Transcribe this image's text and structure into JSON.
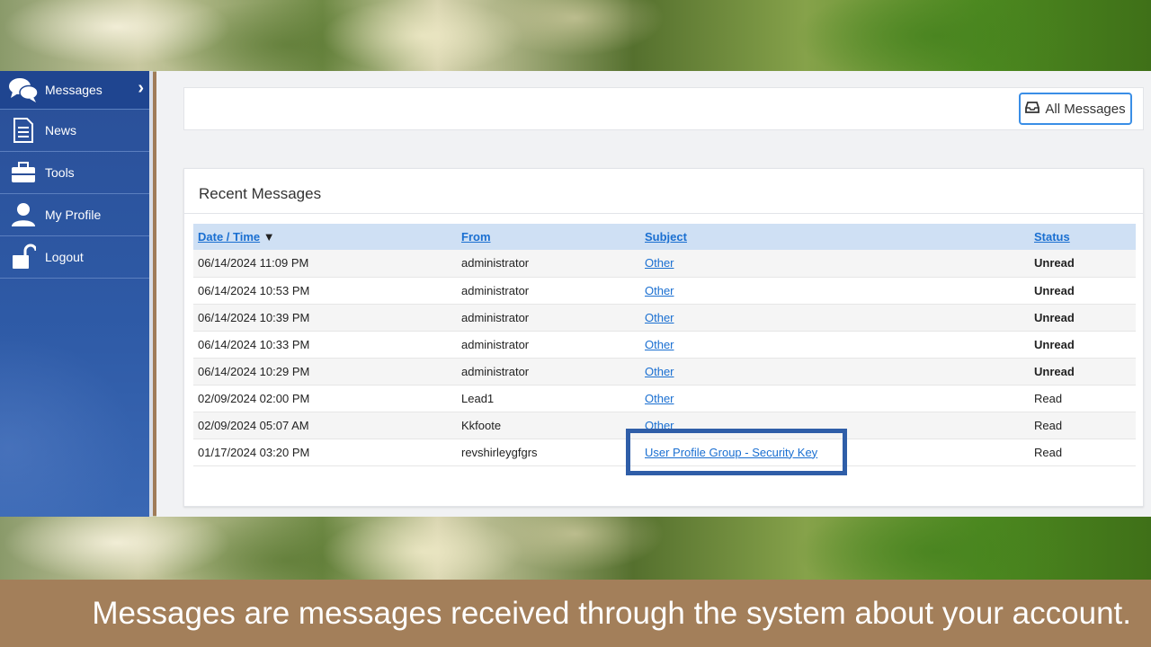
{
  "sidebar": {
    "items": [
      {
        "label": "Messages",
        "icon": "chat-bubbles-icon"
      },
      {
        "label": "News",
        "icon": "document-icon"
      },
      {
        "label": "Tools",
        "icon": "toolbox-icon"
      },
      {
        "label": "My Profile",
        "icon": "user-icon"
      },
      {
        "label": "Logout",
        "icon": "unlock-icon"
      }
    ]
  },
  "toolbar": {
    "all_messages_label": "All Messages",
    "icon": "inbox-icon"
  },
  "recent": {
    "title": "Recent Messages",
    "columns": {
      "datetime": "Date / Time",
      "sort_indicator": "▼",
      "from": "From",
      "subject": "Subject",
      "status": "Status"
    },
    "rows": [
      {
        "datetime": "06/14/2024 11:09 PM",
        "from": "administrator",
        "subject": "Other",
        "status": "Unread"
      },
      {
        "datetime": "06/14/2024 10:53 PM",
        "from": "administrator",
        "subject": "Other",
        "status": "Unread"
      },
      {
        "datetime": "06/14/2024 10:39 PM",
        "from": "administrator",
        "subject": "Other",
        "status": "Unread"
      },
      {
        "datetime": "06/14/2024 10:33 PM",
        "from": "administrator",
        "subject": "Other",
        "status": "Unread"
      },
      {
        "datetime": "06/14/2024 10:29 PM",
        "from": "administrator",
        "subject": "Other",
        "status": "Unread"
      },
      {
        "datetime": "02/09/2024 02:00 PM",
        "from": "Lead1",
        "subject": "Other",
        "status": "Read"
      },
      {
        "datetime": "02/09/2024 05:07 AM",
        "from": "Kkfoote",
        "subject": "Other",
        "status": "Read"
      },
      {
        "datetime": "01/17/2024 03:20 PM",
        "from": "revshirleygfgrs",
        "subject": "User Profile Group - Security Key",
        "status": "Read"
      }
    ]
  },
  "caption": {
    "text": "Messages are messages received through the system about your account."
  },
  "colors": {
    "sidebar": "#2e5aa6",
    "link": "#1a6fd1",
    "highlight": "#2f5ea8",
    "caption_bg": "#a37f5a"
  }
}
